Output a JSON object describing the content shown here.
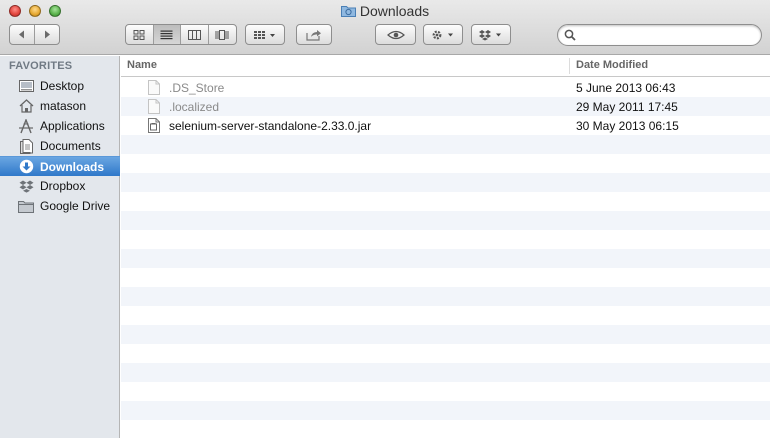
{
  "window": {
    "title": "Downloads"
  },
  "search": {
    "value": "",
    "placeholder": ""
  },
  "sidebar": {
    "heading": "FAVORITES",
    "items": [
      {
        "label": "Desktop",
        "icon": "desktop-icon",
        "selected": false
      },
      {
        "label": "matason",
        "icon": "home-icon",
        "selected": false
      },
      {
        "label": "Applications",
        "icon": "applications-icon",
        "selected": false
      },
      {
        "label": "Documents",
        "icon": "documents-icon",
        "selected": false
      },
      {
        "label": "Downloads",
        "icon": "downloads-icon",
        "selected": true
      },
      {
        "label": "Dropbox",
        "icon": "dropbox-icon",
        "selected": false
      },
      {
        "label": "Google Drive",
        "icon": "folder-icon",
        "selected": false
      }
    ]
  },
  "list": {
    "columns": {
      "name": "Name",
      "date_modified": "Date Modified"
    },
    "files": [
      {
        "name": ".DS_Store",
        "date_modified": "5 June 2013 06:43",
        "hidden": true
      },
      {
        "name": ".localized",
        "date_modified": "29 May 2011 17:45",
        "hidden": true
      },
      {
        "name": "selenium-server-standalone-2.33.0.jar",
        "date_modified": "30 May 2013 06:15",
        "hidden": false
      }
    ]
  },
  "colors": {
    "selection": "#3a82d0",
    "sidebar_bg": "#e3e7ec",
    "alt_row": "#f2f5fa"
  }
}
